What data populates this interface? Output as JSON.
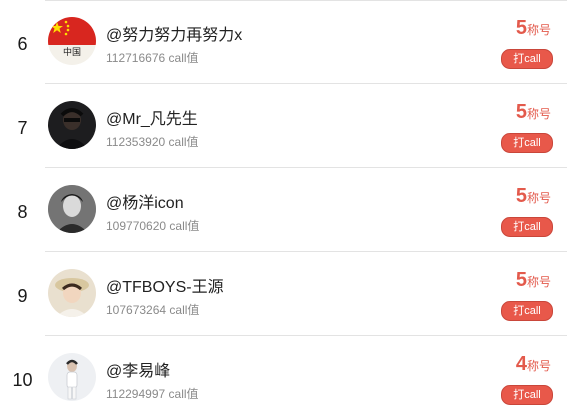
{
  "list": [
    {
      "rank": "6",
      "name": "@努力努力再努力x",
      "score": "112716676",
      "score_suffix": "call值",
      "title_num": "5",
      "title_txt": "称号",
      "button": "打call",
      "avatar_icon": "china-flag-avatar-icon",
      "avatar_text": "中国"
    },
    {
      "rank": "7",
      "name": "@Mr_凡先生",
      "score": "112353920",
      "score_suffix": "call值",
      "title_num": "5",
      "title_txt": "称号",
      "button": "打call",
      "avatar_icon": "person-avatar-icon"
    },
    {
      "rank": "8",
      "name": "@杨洋icon",
      "score": "109770620",
      "score_suffix": "call值",
      "title_num": "5",
      "title_txt": "称号",
      "button": "打call",
      "avatar_icon": "person-avatar-icon"
    },
    {
      "rank": "9",
      "name": "@TFBOYS-王源",
      "score": "107673264",
      "score_suffix": "call值",
      "title_num": "5",
      "title_txt": "称号",
      "button": "打call",
      "avatar_icon": "person-avatar-icon"
    },
    {
      "rank": "10",
      "name": "@李易峰",
      "score": "112294997",
      "score_suffix": "call值",
      "title_num": "4",
      "title_txt": "称号",
      "button": "打call",
      "avatar_icon": "person-avatar-icon"
    }
  ],
  "colors": {
    "accent": "#e35a4c",
    "button_bg": "#e8584a"
  }
}
